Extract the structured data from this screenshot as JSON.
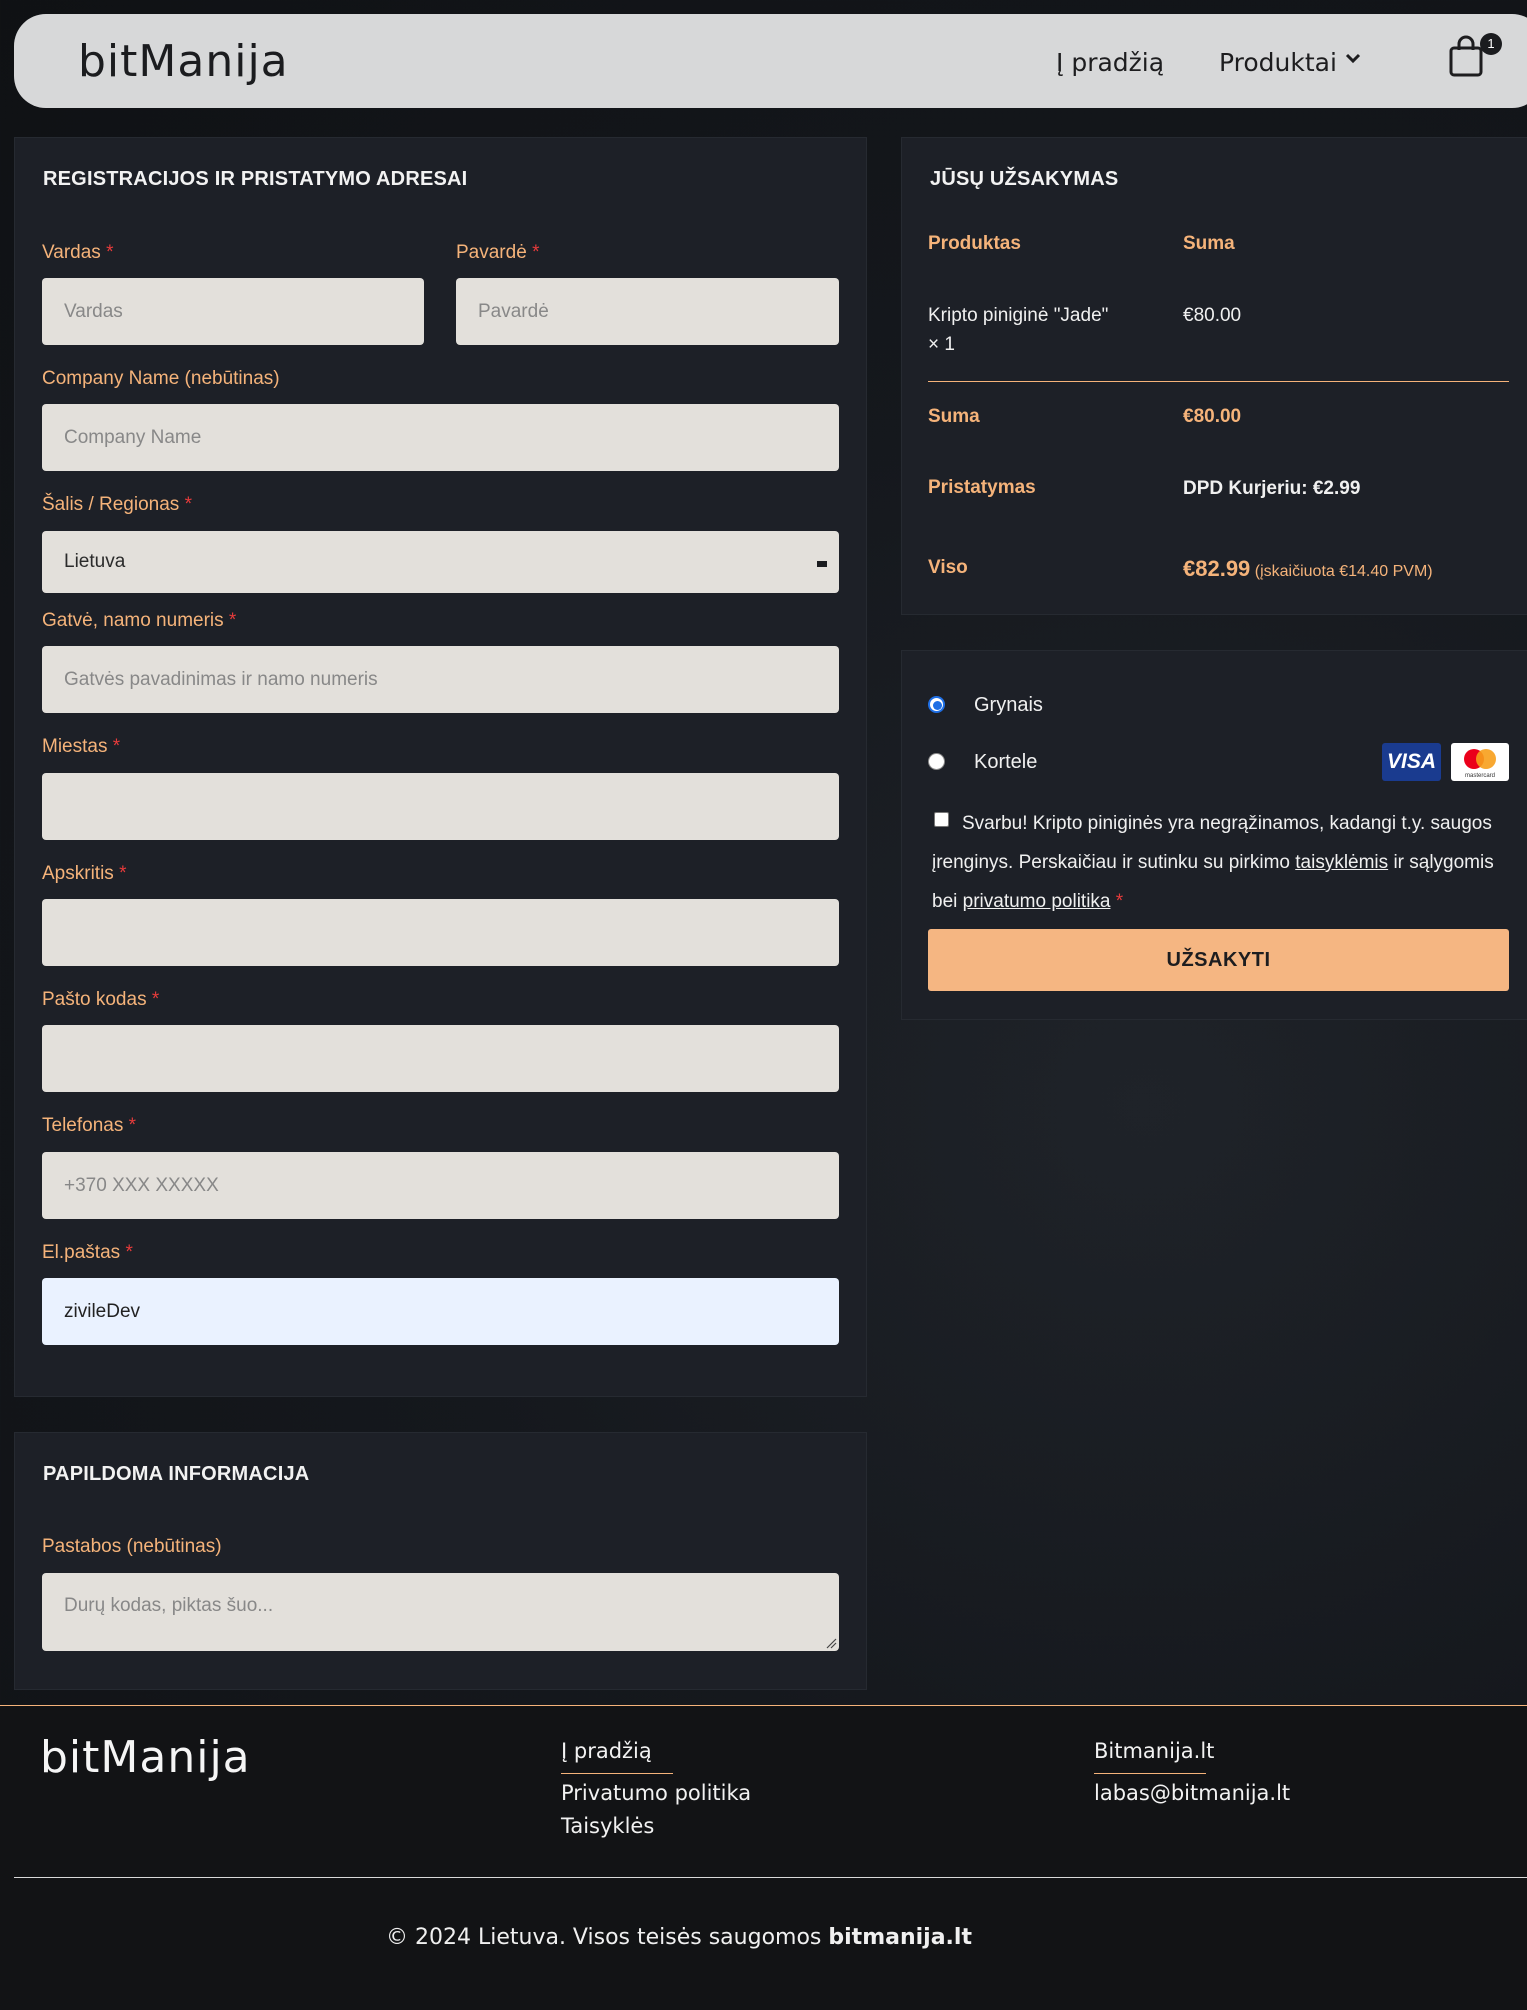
{
  "header": {
    "logo": "bitManija",
    "nav_home": "Į pradžią",
    "nav_products": "Produktai",
    "cart_count": "1"
  },
  "billing": {
    "title": "REGISTRACIJOS IR PRISTATYMO ADRESAI",
    "required_mark": "*",
    "first_name": {
      "label": "Vardas",
      "placeholder": "Vardas"
    },
    "last_name": {
      "label": "Pavardė",
      "placeholder": "Pavardė"
    },
    "company": {
      "label": "Company Name (nebūtinas)",
      "placeholder": "Company Name"
    },
    "country": {
      "label": "Šalis / Regionas",
      "value": "Lietuva"
    },
    "street": {
      "label": "Gatvė, namo numeris",
      "placeholder": "Gatvės pavadinimas ir namo numeris"
    },
    "city": {
      "label": "Miestas",
      "placeholder": ""
    },
    "county": {
      "label": "Apskritis",
      "placeholder": ""
    },
    "postcode": {
      "label": "Pašto kodas",
      "placeholder": ""
    },
    "phone": {
      "label": "Telefonas",
      "placeholder": "+370 XXX XXXXX"
    },
    "email": {
      "label": "El.paštas",
      "value": "zivileDev"
    }
  },
  "additional": {
    "title": "PAPILDOMA INFORMACIJA",
    "notes": {
      "label": "Pastabos (nebūtinas)",
      "placeholder": "Durų kodas, piktas šuo..."
    }
  },
  "order": {
    "title": "JŪSŲ UŽSAKYMAS",
    "col_product": "Produktas",
    "col_sum": "Suma",
    "item_name": "Kripto piniginė \"Jade\"",
    "item_qty": "× 1",
    "item_price": "€80.00",
    "subtotal_label": "Suma",
    "subtotal_value": "€80.00",
    "shipping_label": "Pristatymas",
    "shipping_value": "DPD Kurjeriu: €2.99",
    "total_label": "Viso",
    "total_value": "€82.99",
    "total_tax": "(įskaičiuota €14.40 PVM)"
  },
  "payment": {
    "cash_label": "Grynais",
    "card_label": "Kortele",
    "visa_text": "VISA",
    "mc_text": "mastercard",
    "terms_text": "Svarbu! Kripto piniginės yra negrąžinamos, kadangi t.y. saugos įrenginys. Perskaičiau ir sutinku su pirkimo",
    "terms_link": "taisyklėmis",
    "terms_mid": "ir sąlygomis bei",
    "privacy_link": "privatumo politika",
    "required_mark": "*",
    "order_button": "UŽSAKYTI"
  },
  "footer": {
    "logo": "bitManija",
    "link_home": "Į pradžią",
    "link_privacy": "Privatumo politika",
    "link_rules": "Taisyklės",
    "site": "Bitmanija.lt",
    "email": "labas@bitmanija.lt",
    "copyright": "© 2024 Lietuva. Visos teisės saugomos",
    "copyright_brand": "bitmanija.lt"
  },
  "colors": {
    "accent": "#f5b37a",
    "required": "#e63b3b",
    "panel": "#1d2027",
    "input": "#e3e0db",
    "button": "#f5b682"
  }
}
